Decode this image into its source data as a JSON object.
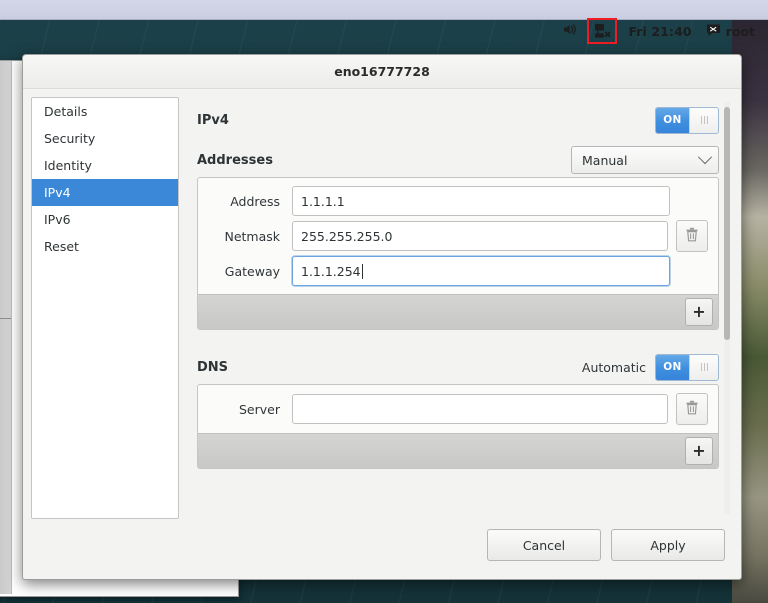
{
  "panel": {
    "volume_icon": "speaker-icon",
    "network_icon": "network-disconnected-icon",
    "clock": "Fri 21:40",
    "user_icon": "chat-icon",
    "user": "root"
  },
  "dialog": {
    "title": "eno16777728",
    "sidebar": {
      "items": [
        {
          "label": "Details",
          "selected": false
        },
        {
          "label": "Security",
          "selected": false
        },
        {
          "label": "Identity",
          "selected": false
        },
        {
          "label": "IPv4",
          "selected": true
        },
        {
          "label": "IPv6",
          "selected": false
        },
        {
          "label": "Reset",
          "selected": false
        }
      ]
    },
    "ipv4": {
      "title": "IPv4",
      "toggle_label": "ON",
      "toggle_state": "on"
    },
    "addresses": {
      "title": "Addresses",
      "method": "Manual",
      "rows": [
        {
          "label": "Address",
          "value": "1.1.1.1",
          "focused": false,
          "has_delete": false
        },
        {
          "label": "Netmask",
          "value": "255.255.255.0",
          "focused": false,
          "has_delete": true
        },
        {
          "label": "Gateway",
          "value": "1.1.1.254",
          "focused": true,
          "has_delete": false
        }
      ],
      "add_label": "+",
      "delete_icon": "trash-icon"
    },
    "dns": {
      "title": "DNS",
      "automatic_label": "Automatic",
      "toggle_label": "ON",
      "toggle_state": "on",
      "rows": [
        {
          "label": "Server",
          "value": "",
          "placeholder": "",
          "focused": false,
          "has_delete": true
        }
      ],
      "add_label": "+",
      "delete_icon": "trash-icon"
    },
    "actions": {
      "cancel": "Cancel",
      "apply": "Apply"
    }
  },
  "colors": {
    "accent": "#3b88d8",
    "toggle_on": "#3f8ede",
    "highlight_box": "#ee1d25",
    "desktop": "#1b4049"
  }
}
